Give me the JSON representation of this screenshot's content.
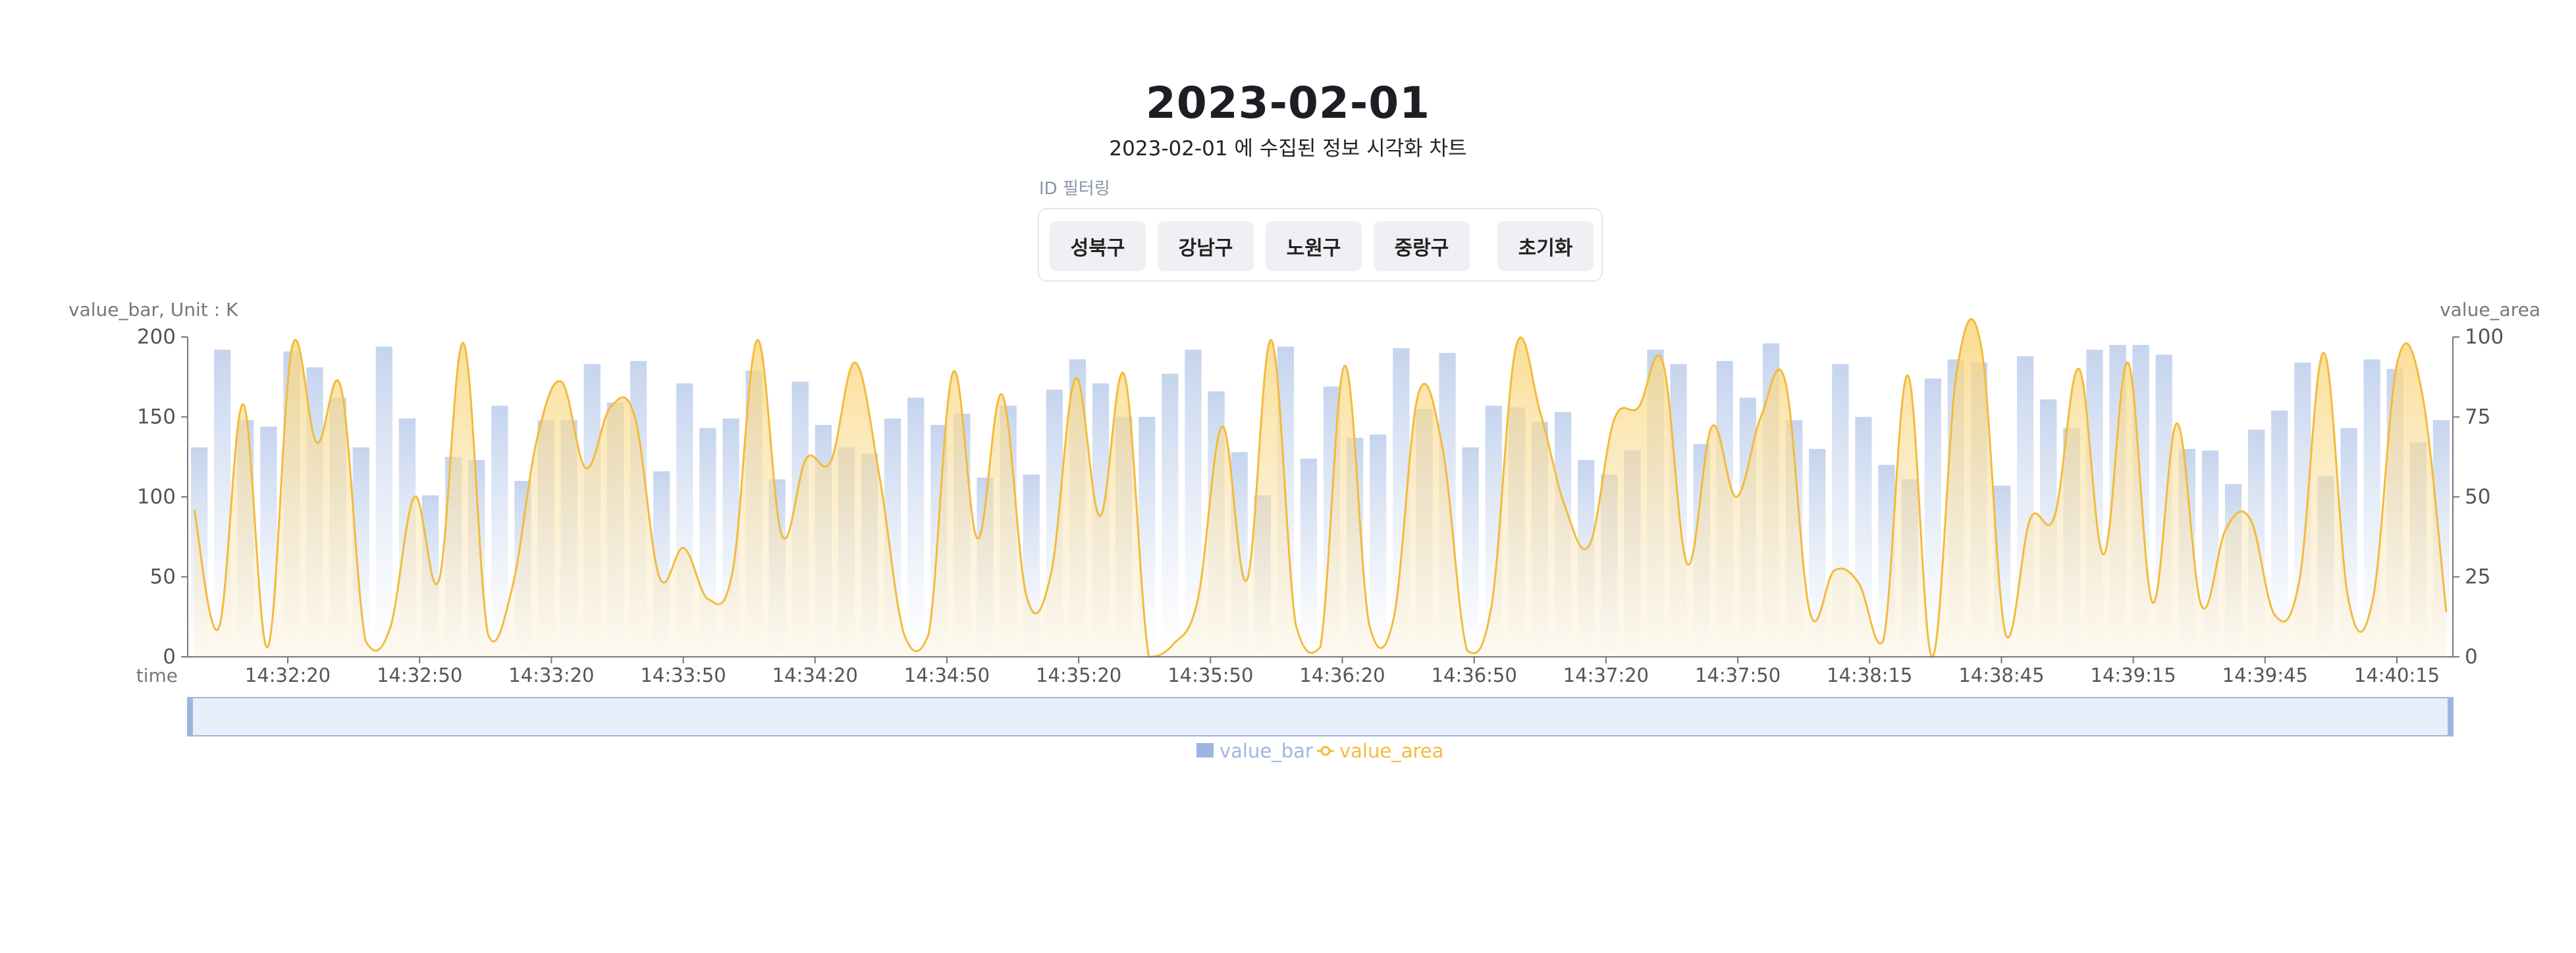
{
  "title": "2023-02-01",
  "subtitle": "2023-02-01 에 수집된 정보 시각화 차트",
  "filter": {
    "label": "ID 필터링",
    "buttons": [
      "성북구",
      "강남구",
      "노원구",
      "중랑구"
    ],
    "reset_label": "초기화"
  },
  "colors": {
    "bar": "#c5d4ee",
    "area_line": "#f2bb3d",
    "area_fill": "#fad57a",
    "legend_bar": "#9fb4e0",
    "axis": "#666666"
  },
  "chart_data": {
    "type": "bar",
    "title": "2023-02-01",
    "subtitle": "2023-02-01 에 수집된 정보 시각화 차트",
    "xlabel": "time",
    "ylabel_left": "value_bar, Unit : K",
    "ylabel_right": "value_area",
    "ylim_left": [
      0,
      200
    ],
    "ylim_right": [
      0,
      100
    ],
    "yticks_left": [
      "0",
      "50",
      "100",
      "150",
      "200"
    ],
    "yticks_right": [
      "0",
      "25",
      "50",
      "75",
      "100"
    ],
    "xticks": [
      "14:32:20",
      "14:32:50",
      "14:33:20",
      "14:33:50",
      "14:34:20",
      "14:34:50",
      "14:35:20",
      "14:35:50",
      "14:36:20",
      "14:36:50",
      "14:37:20",
      "14:37:50",
      "14:38:15",
      "14:38:45",
      "14:39:15",
      "14:39:45",
      "14:40:15"
    ],
    "legend": [
      "value_bar",
      "value_area"
    ],
    "legend_position": "bottom",
    "series": [
      {
        "name": "value_bar",
        "type": "bar",
        "axis": "left",
        "values": [
          131,
          192,
          148,
          144,
          191,
          181,
          162,
          131,
          194,
          149,
          101,
          125,
          123,
          157,
          110,
          148,
          148,
          183,
          159,
          185,
          116,
          171,
          143,
          149,
          179,
          111,
          172,
          145,
          131,
          127,
          149,
          162,
          145,
          152,
          112,
          157,
          114,
          167,
          186,
          171,
          150,
          150,
          177,
          192,
          166,
          128,
          101,
          194,
          124,
          169,
          137,
          139,
          193,
          155,
          190,
          131,
          157,
          156,
          147,
          153,
          123,
          114,
          129,
          192,
          183,
          133,
          185,
          162,
          196,
          148,
          130,
          183,
          150,
          120,
          111,
          174,
          186,
          184,
          107,
          188,
          161,
          143,
          192,
          195,
          195,
          189,
          130,
          129,
          108,
          142,
          154,
          184,
          113,
          143,
          186,
          180,
          134,
          148
        ]
      },
      {
        "name": "value_area",
        "type": "area",
        "axis": "right",
        "values": [
          46,
          9,
          79,
          3,
          97,
          67,
          84,
          5,
          9,
          50,
          24,
          98,
          7,
          22,
          68,
          86,
          59,
          78,
          75,
          25,
          34,
          18,
          27,
          99,
          38,
          62,
          61,
          92,
          56,
          7,
          7,
          89,
          37,
          82,
          19,
          26,
          87,
          44,
          88,
          0,
          4,
          18,
          72,
          24,
          99,
          10,
          3,
          91,
          10,
          12,
          82,
          65,
          2,
          16,
          97,
          76,
          47,
          35,
          74,
          78,
          92,
          29,
          72,
          50,
          75,
          86,
          14,
          27,
          23,
          5,
          88,
          0,
          89,
          97,
          7,
          43,
          44,
          90,
          32,
          92,
          17,
          73,
          16,
          40,
          43,
          13,
          24,
          95,
          18,
          18,
          92,
          83,
          14
        ]
      }
    ]
  }
}
